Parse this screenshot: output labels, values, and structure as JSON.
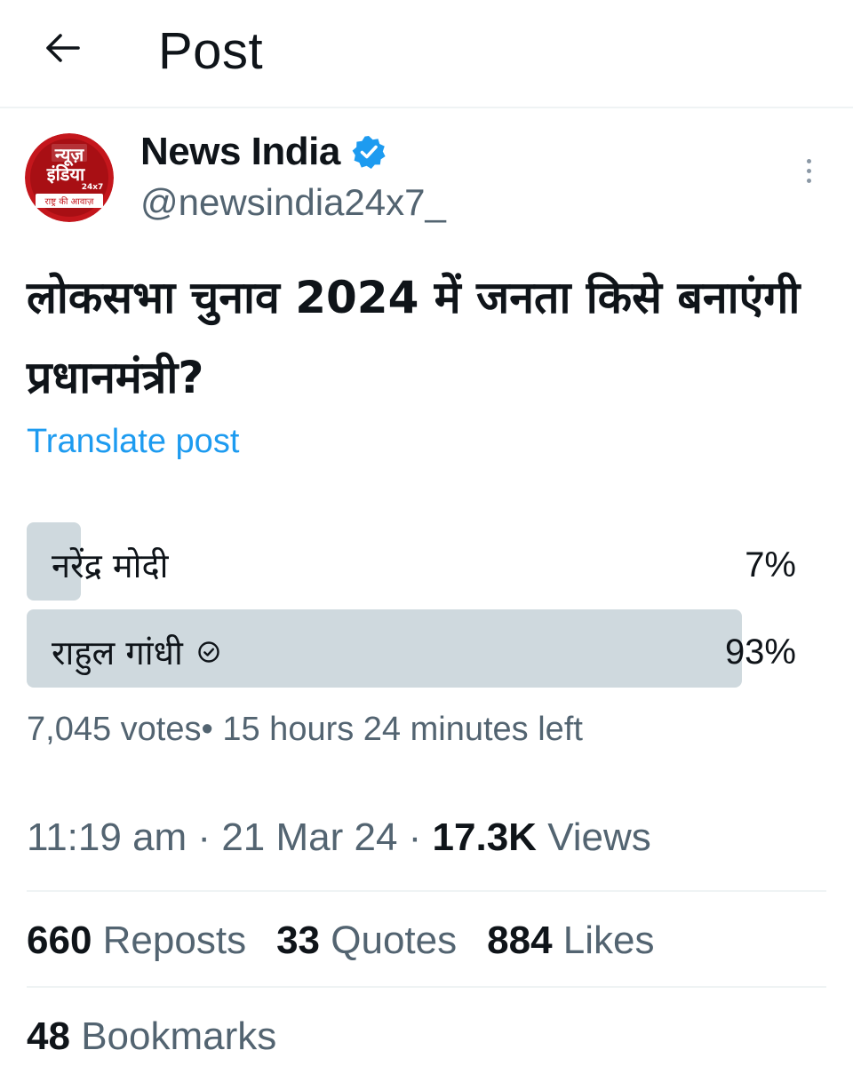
{
  "header": {
    "title": "Post",
    "back_icon": "arrow-left-icon"
  },
  "author": {
    "name": "News India",
    "handle": "@newsindia24x7_",
    "verified": true,
    "verified_color": "#1d9bf0",
    "avatar": {
      "line1": "न्यूज़",
      "line2": "इंडिया",
      "badge": "24x7",
      "tagline": "राष्ट्र की आवाज़",
      "bg_color": "#c4161c"
    }
  },
  "post": {
    "text": "लोकसभा चुनाव 2024 में जनता किसे बनाएंगी प्रधानमंत्री?",
    "translate_label": "Translate post"
  },
  "poll": {
    "options": [
      {
        "label": "नरेंद्र मोदी",
        "percent_label": "7%",
        "percent": 7,
        "winner": false
      },
      {
        "label": "राहुल गांधी",
        "percent_label": "93%",
        "percent": 93,
        "winner": true
      }
    ],
    "votes": "7,045 votes",
    "time_left": "15 hours 24 minutes left",
    "bar_color": "#cfd9de"
  },
  "meta": {
    "time": "11:19 am",
    "date": "21 Mar 24",
    "views_count": "17.3K",
    "views_label": "Views"
  },
  "stats": {
    "reposts_count": "660",
    "reposts_label": "Reposts",
    "quotes_count": "33",
    "quotes_label": "Quotes",
    "likes_count": "884",
    "likes_label": "Likes",
    "bookmarks_count": "48",
    "bookmarks_label": "Bookmarks"
  }
}
